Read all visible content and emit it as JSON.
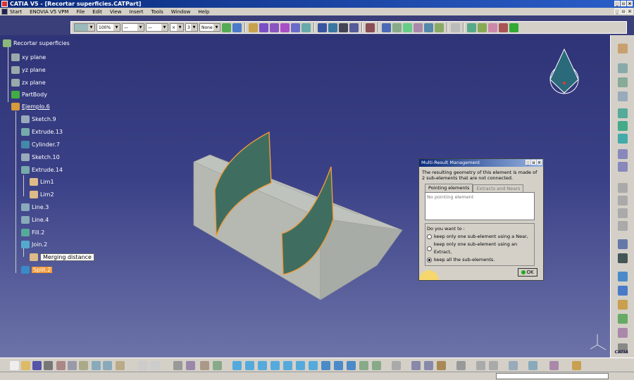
{
  "window": {
    "title": "CATIA V5 - [Recortar superficies.CATPart]"
  },
  "menu": {
    "items": [
      "Start",
      "ENOVIA V5 VPM",
      "File",
      "Edit",
      "View",
      "Insert",
      "Tools",
      "Window",
      "Help"
    ]
  },
  "toolbar_top": {
    "zoom": "100%",
    "layer": "None",
    "color_box": "",
    "line_num": "3"
  },
  "tree": {
    "root": "Recortar superficies",
    "nodes": [
      "xy plane",
      "yz plane",
      "zx plane",
      "PartBody",
      "Ejemplo.6",
      "Sketch.9",
      "Extrude.13",
      "Cylinder.7",
      "Sketch.10",
      "Extrude.14",
      "Lim1",
      "Lim2",
      "Line.3",
      "Line.4",
      "Fill.2",
      "Join.2",
      "Merging distance",
      "Split.2"
    ]
  },
  "dialog": {
    "title": "Multi-Result Management",
    "message": "The resulting geometry of this element is made of 2 sub-elements that are not connected.",
    "tab_pointing": "Pointing elements",
    "tab_extracts": "Extracts and Nears",
    "list_placeholder": "No pointing element",
    "question": "Do you want to :",
    "options": [
      "keep only one sub-element using a Near,",
      "keep only one sub-element using an Extract,",
      "keep all the sub-elements."
    ],
    "selected_option": 2,
    "ok_label": "OK"
  },
  "logo": {
    "text": "CATIA"
  },
  "colors": {
    "background": "#3a3f7a",
    "highlight": "#f29a3a",
    "part_surface": "#c8ccc8",
    "surface_green": "#3f6e60"
  }
}
